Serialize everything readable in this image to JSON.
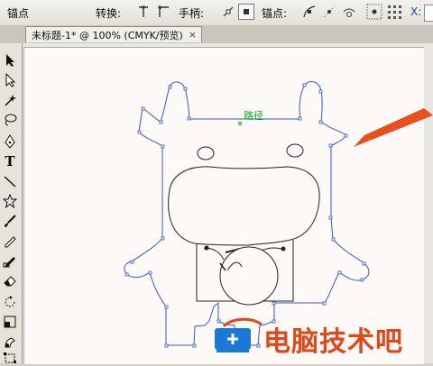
{
  "control_bar": {
    "anchor_label": "锚点",
    "convert_label": "转换:",
    "handles_label": "手柄:",
    "anchor_points_label": "锚点:",
    "x_label": "X:"
  },
  "document_tab": {
    "title": "未标题-1* @ 100% (CMYK/预览)",
    "close": "×"
  },
  "canvas": {
    "path_label": "路径"
  },
  "watermark": {
    "text": "电脑技术吧"
  },
  "colors": {
    "path_stroke": "#3a56c8",
    "arrow": "#e8501e",
    "watermark": "#e0481c"
  }
}
